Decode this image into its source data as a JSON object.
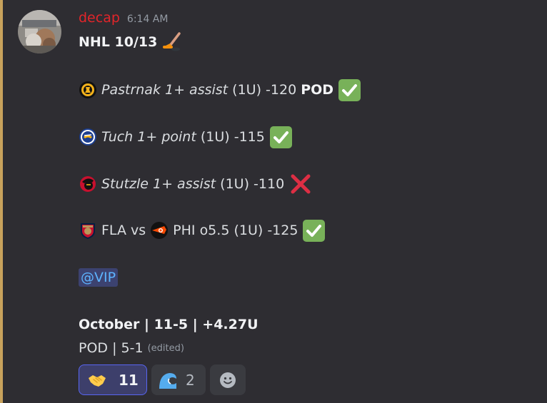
{
  "message": {
    "username": "decap",
    "timestamp": "6:14 AM",
    "title": "NHL 10/13",
    "picks": [
      {
        "player": "Pastrnak",
        "market": "1+ assist",
        "units": "(1U)",
        "odds": "-120",
        "tag": "POD",
        "result": "check"
      },
      {
        "player": "Tuch",
        "market": "1+ point",
        "units": "(1U)",
        "odds": "-115",
        "result": "check"
      },
      {
        "player": "Stutzle",
        "market": "1+ assist",
        "units": "(1U)",
        "odds": "-110",
        "result": "cross"
      },
      {
        "team_a": "FLA",
        "vs": "vs",
        "team_b": "PHI",
        "total": "o5.5",
        "units": "(1U)",
        "odds": "-125",
        "result": "check"
      }
    ],
    "mention": "@VIP",
    "record_month": "October | 11-5 | +4.27U",
    "record_pod": "POD | 5-1",
    "edited": "(edited)"
  },
  "reactions": [
    {
      "icon": "handshake-icon",
      "count": "11",
      "active": true
    },
    {
      "icon": "wave-icon",
      "count": "2",
      "active": false
    },
    {
      "icon": "add-reaction-icon"
    }
  ],
  "colors": {
    "username": "#e3252a",
    "accent": "#c8a25c",
    "mention": "#5db4ff",
    "check": "#78b159",
    "cross": "#dd2e44"
  }
}
